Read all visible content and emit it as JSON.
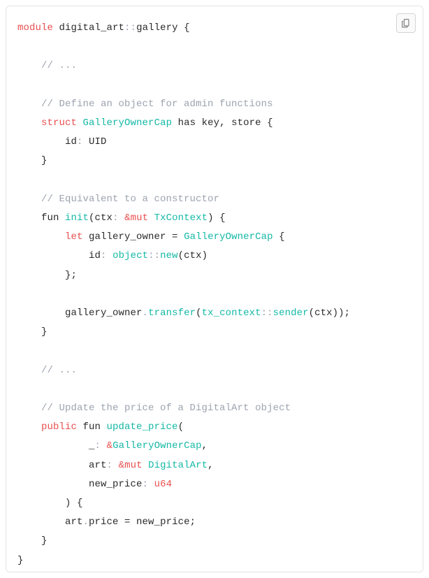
{
  "code": {
    "line1": {
      "kw1": "module",
      "ns1": "digital_art",
      "op": "::",
      "ns2": "gallery",
      "brace": " {"
    },
    "line3": {
      "comment": "// ..."
    },
    "line5": {
      "comment": "// Define an object for admin functions"
    },
    "line6": {
      "kw1": "struct",
      "type": "GalleryOwnerCap",
      "rest": " has key, store {"
    },
    "line7": {
      "id": "id",
      "colon": ": ",
      "type": "UID"
    },
    "line8": {
      "brace": "}"
    },
    "line10": {
      "comment": "// Equivalent to a constructor"
    },
    "line11": {
      "pre": "fun ",
      "fn": "init",
      "open": "(ctx",
      "colon": ": ",
      "amp": "&mut ",
      "type": "TxContext",
      "close": ") {"
    },
    "line12": {
      "kw": "let",
      "var": " gallery_owner = ",
      "type": "GalleryOwnerCap",
      "brace": " {"
    },
    "line13": {
      "id": "id",
      "colon": ": ",
      "ns": "object",
      "op": "::",
      "fn": "new",
      "args": "(ctx)"
    },
    "line14": {
      "close": "};"
    },
    "line16": {
      "pre": "gallery_owner",
      "dot": ".",
      "fn": "transfer",
      "open": "(",
      "ns": "tx_context",
      "op": "::",
      "fn2": "sender",
      "args": "(ctx));"
    },
    "line17": {
      "brace": "}"
    },
    "line19": {
      "comment": "// ..."
    },
    "line21": {
      "comment": "// Update the price of a DigitalArt object"
    },
    "line22": {
      "kw": "public",
      "pre": " fun ",
      "fn": "update_price",
      "open": "("
    },
    "line23": {
      "under": "_",
      "colon": ": ",
      "amp": "&",
      "type": "GalleryOwnerCap",
      "comma": ","
    },
    "line24": {
      "param": "art",
      "colon": ": ",
      "amp": "&mut ",
      "type": "DigitalArt",
      "comma": ","
    },
    "line25": {
      "param": "new_price",
      "colon": ": ",
      "type": "u64"
    },
    "line26": {
      "close": ") {"
    },
    "line27": {
      "stmt1": "art",
      "dot": ".",
      "stmt2": "price = new_price;"
    },
    "line28": {
      "brace": "}"
    },
    "line29": {
      "brace": "}"
    }
  },
  "copy_label": "Copy"
}
